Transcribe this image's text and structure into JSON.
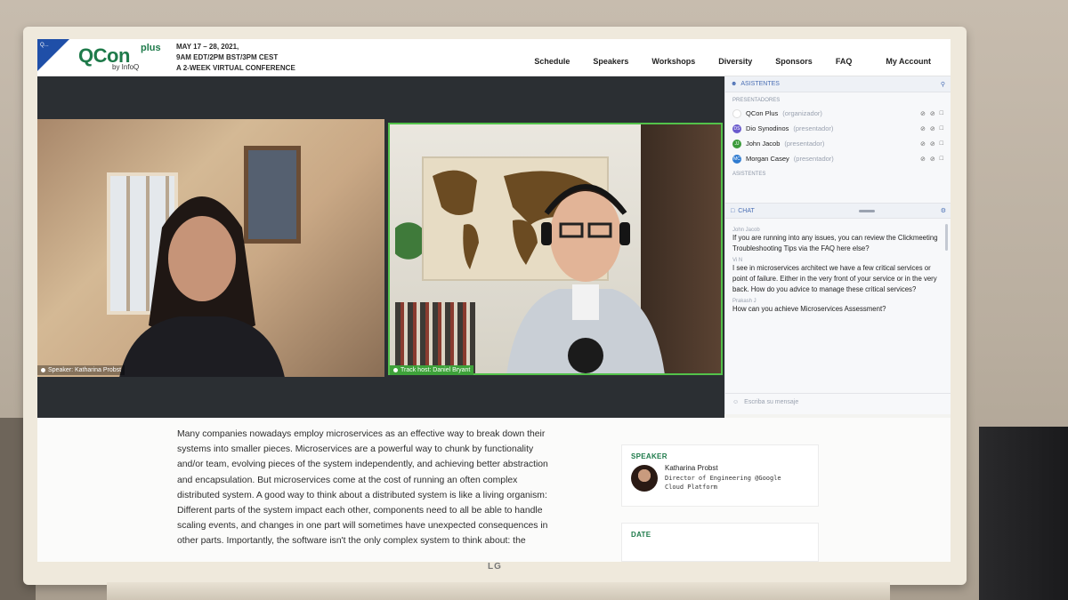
{
  "header": {
    "logo_badge": "Q...",
    "logo": "QCon",
    "logo_plus": "plus",
    "logo_by": "by InfoQ",
    "dates": "MAY 17 – 28, 2021,",
    "time": "9AM EDT/2PM BST/3PM CEST",
    "tagline": "A 2-WEEK VIRTUAL CONFERENCE",
    "nav": [
      "Schedule",
      "Speakers",
      "Workshops",
      "Diversity",
      "Sponsors",
      "FAQ",
      "My Account"
    ]
  },
  "video": {
    "left_caption": "Speaker: Katharina Probst",
    "right_caption": "Track host: Daniel Bryant"
  },
  "sidebar": {
    "attendees_label": "ASISTENTES",
    "presenters_label": "PRESENTADORES",
    "attendees_section_label": "ASISTENTES",
    "participants": [
      {
        "name": "QCon Plus",
        "role": "(organizador)",
        "initials": "",
        "color": "#ffffff"
      },
      {
        "name": "Dio Synodinos",
        "role": "(presentador)",
        "initials": "DS",
        "color": "#6a5acd"
      },
      {
        "name": "John Jacob",
        "role": "(presentador)",
        "initials": "JJ",
        "color": "#3a9a3a"
      },
      {
        "name": "Morgan Casey",
        "role": "(presentador)",
        "initials": "MC",
        "color": "#2f7bd0"
      }
    ],
    "chat_label": "CHAT",
    "messages": [
      {
        "author": "John Jacob",
        "text": "If you are running into any issues, you can review the Clickmeeting Troubleshooting Tips via the FAQ here else?"
      },
      {
        "author": "Vi N",
        "text": "I see in microservices architect we have a few critical services or point of failure. Either in the very front of your service or in the very back. How do you advice to manage these critical services?"
      },
      {
        "author": "Prakash J",
        "text": "How can you achieve Microservices Assessment?"
      }
    ],
    "chat_placeholder": "Escriba su mensaje"
  },
  "article": {
    "body": "Many companies nowadays employ microservices as an effective way to break down their systems into smaller pieces. Microservices are a powerful way to chunk by functionality and/or team, evolving pieces of the system independently, and achieving better abstraction and encapsulation. But microservices come at the cost of running an often complex distributed system. A good way to think about a distributed system is like a living organism: Different parts of the system impact each other, components need to all be able to handle scaling events, and changes in one part will sometimes have unexpected consequences in other parts. Importantly, the software isn't the only complex system to think about: the"
  },
  "speaker_card": {
    "label": "SPEAKER",
    "name": "Katharina Probst",
    "title_line1": "Director of Engineering @Google",
    "title_line2": "Cloud Platform"
  },
  "date_card": {
    "label": "DATE"
  },
  "tv_brand": "LG",
  "colors": {
    "brand_green": "#1e7a4a",
    "host_border": "#53c24a",
    "sidebar_accent": "#4a6fb5"
  }
}
